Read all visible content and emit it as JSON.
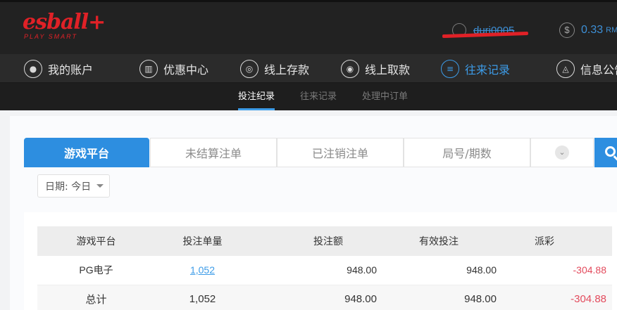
{
  "header": {
    "logo_main": "esball+",
    "logo_sub": "PLAY SMART",
    "username": "duri0005",
    "balance": "0.33",
    "currency": "RM"
  },
  "nav": [
    {
      "label": "我的账户",
      "icon": "user-icon"
    },
    {
      "label": "优惠中心",
      "icon": "gift-icon"
    },
    {
      "label": "线上存款",
      "icon": "deposit-icon"
    },
    {
      "label": "线上取款",
      "icon": "withdraw-icon"
    },
    {
      "label": "往来记录",
      "icon": "records-icon",
      "active": true
    },
    {
      "label": "信息公告",
      "icon": "bell-icon"
    }
  ],
  "subnav": [
    {
      "label": "投注纪录",
      "active": true
    },
    {
      "label": "往来记录"
    },
    {
      "label": "处理中订单"
    }
  ],
  "tabs": [
    {
      "label": "游戏平台",
      "active": true
    },
    {
      "label": "未结算注单"
    },
    {
      "label": "已注销注单"
    },
    {
      "label": "局号/期数"
    }
  ],
  "date_filter": "日期: 今日",
  "table": {
    "headers": [
      "游戏平台",
      "投注单量",
      "投注额",
      "有效投注",
      "派彩"
    ],
    "rows": [
      {
        "platform": "PG电子",
        "count": "1,052",
        "bet": "948.00",
        "valid": "948.00",
        "payout": "-304.88"
      }
    ],
    "total": {
      "platform": "总计",
      "count": "1,052",
      "bet": "948.00",
      "valid": "948.00",
      "payout": "-304.88"
    }
  },
  "colors": {
    "accent": "#2d8ee0",
    "brand_red": "#e02127",
    "negative": "#e34b5d"
  }
}
